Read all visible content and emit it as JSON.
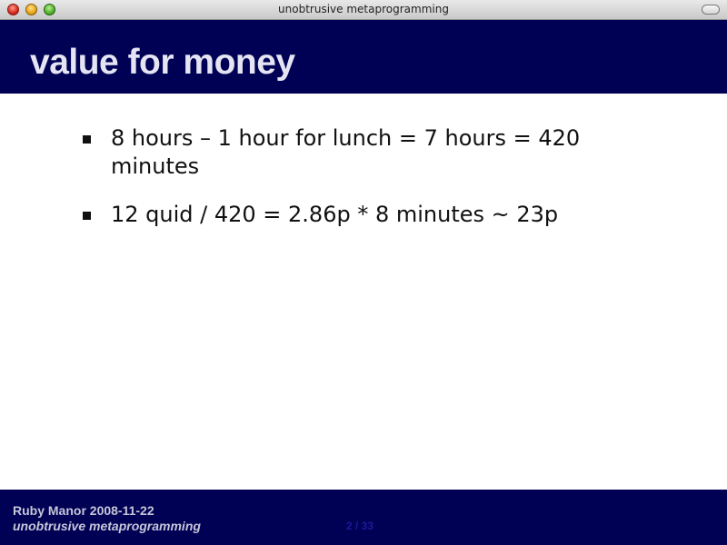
{
  "window": {
    "title": "unobtrusive metaprogramming"
  },
  "slide": {
    "title": "value for money",
    "bullets": [
      "8 hours – 1 hour for lunch = 7 hours = 420 minutes",
      "12 quid / 420 = 2.86p * 8 minutes ~ 23p"
    ]
  },
  "footer": {
    "line1": "Ruby Manor 2008-11-22",
    "line2": "unobtrusive metaprogramming",
    "page_counter": "2 / 33"
  },
  "colors": {
    "header_background": "#000055",
    "title_text": "#e4e4f2",
    "footer_text": "#c6c6d8",
    "page_counter": "#1a1a9a"
  },
  "icons": {
    "close": "close-button-icon",
    "minimize": "minimize-button-icon",
    "zoom": "zoom-button-icon",
    "toolbar_toggle": "toolbar-toggle-icon"
  }
}
